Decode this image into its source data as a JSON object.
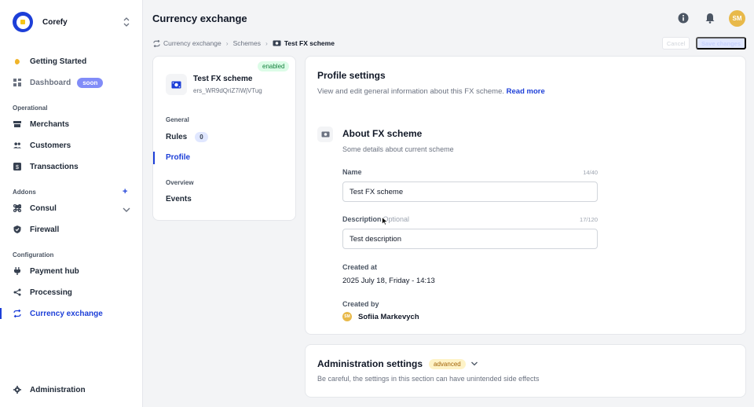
{
  "brand": {
    "name": "Corefy"
  },
  "sidebar": {
    "items": [
      {
        "label": "Getting Started",
        "icon": "wave-hand-icon"
      },
      {
        "label": "Dashboard",
        "badge": "soon",
        "icon": "dashboard-icon"
      }
    ],
    "sections": {
      "operational": {
        "label": "Operational",
        "items": [
          {
            "label": "Merchants",
            "icon": "store-icon"
          },
          {
            "label": "Customers",
            "icon": "users-icon"
          },
          {
            "label": "Transactions",
            "icon": "dollar-icon"
          }
        ]
      },
      "addons": {
        "label": "Addons",
        "add_label": "+",
        "items": [
          {
            "label": "Consul",
            "icon": "command-icon"
          },
          {
            "label": "Firewall",
            "icon": "shield-icon"
          }
        ]
      },
      "configuration": {
        "label": "Configuration",
        "items": [
          {
            "label": "Payment hub",
            "icon": "plug-icon"
          },
          {
            "label": "Processing",
            "icon": "share-icon"
          },
          {
            "label": "Currency exchange",
            "icon": "exchange-icon"
          }
        ]
      }
    },
    "footer": {
      "label": "Administration",
      "icon": "gear-icon"
    }
  },
  "header": {
    "title": "Currency exchange",
    "avatar_initials": "SM"
  },
  "breadcrumb": {
    "items": [
      "Currency exchange",
      "Schemes"
    ],
    "current": "Test FX scheme"
  },
  "actions": {
    "cancel": "Cancel",
    "save": "Save changes"
  },
  "scheme_card": {
    "status": "enabled",
    "name": "Test FX scheme",
    "id": "ers_WR9dQriZ7iWjVTug",
    "general_label": "General",
    "rules_label": "Rules",
    "rules_count": "0",
    "profile_label": "Profile",
    "overview_label": "Overview",
    "events_label": "Events"
  },
  "profile": {
    "title": "Profile settings",
    "description": "View and edit general information about this FX scheme.",
    "read_more": "Read more",
    "about_title": "About FX scheme",
    "about_sub": "Some details about current scheme",
    "name_label": "Name",
    "name_count": "14/40",
    "name_value": "Test FX scheme",
    "description_label": "Description",
    "description_optional": "Optional",
    "description_count": "17/120",
    "description_value": "Test description",
    "created_at_label": "Created at",
    "created_at_value": "2025 July 18, Friday - 14:13",
    "created_by_label": "Created by",
    "created_by_initials": "SM",
    "created_by_value": "Sofiia Markevych"
  },
  "admin": {
    "title": "Administration settings",
    "badge": "advanced",
    "description": "Be careful, the settings in this section can have unintended side effects"
  },
  "colors": {
    "accent": "#1d3fd8",
    "avatar": "#e8b94a",
    "enabled": "#15803d"
  }
}
